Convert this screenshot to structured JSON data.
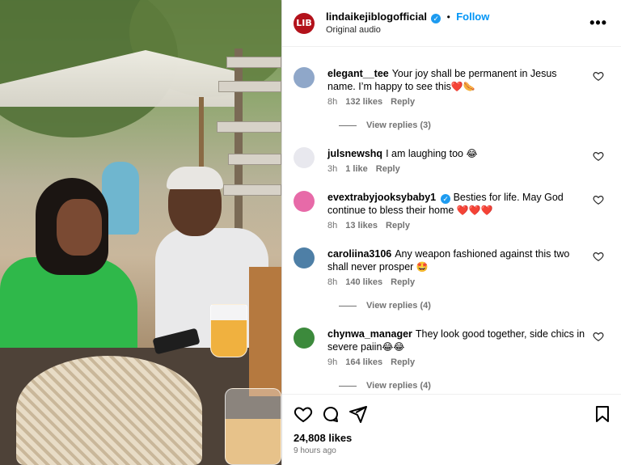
{
  "header": {
    "username": "lindaikejiblogofficial",
    "verified_mark": "✓",
    "dot": "•",
    "follow_label": "Follow",
    "subtitle": "Original audio",
    "avatar_text": "LIB",
    "more_label": "•••"
  },
  "comments": [
    {
      "username": "elegant__tee",
      "text": "Your joy shall be permanent in Jesus name. I’m happy to see this",
      "emoji": "❤️🌭",
      "time": "8h",
      "likes": "132 likes",
      "reply": "Reply",
      "view_replies": "View replies (3)",
      "avatar_color": "#8fa7c9"
    },
    {
      "username": "julsnewshq",
      "text": "I am laughing too",
      "emoji": "😂",
      "time": "3h",
      "likes": "1 like",
      "reply": "Reply",
      "avatar_color": "#e8e8ee"
    },
    {
      "username": "evextrabyjooksybaby1",
      "verified_mark": "✓",
      "text": "Besties for life. May God continue to bless their home",
      "emoji": "❤️❤️❤️",
      "time": "8h",
      "likes": "13 likes",
      "reply": "Reply",
      "avatar_color": "#e76aa8"
    },
    {
      "username": "caroliina3106",
      "text": "Any weapon fashioned against this two shall never prosper",
      "emoji": "🤩",
      "time": "8h",
      "likes": "140 likes",
      "reply": "Reply",
      "view_replies": "View replies (4)",
      "avatar_color": "#4e7fa6"
    },
    {
      "username": "chynwa_manager",
      "text": "They look good together, side chics in severe paiin",
      "emoji": "😂😂",
      "time": "9h",
      "likes": "164 likes",
      "reply": "Reply",
      "view_replies": "View replies (4)",
      "avatar_color": "#3c8a3c"
    }
  ],
  "footer": {
    "likes": "24,808 likes",
    "time": "9 hours ago"
  },
  "icons": [
    "like-icon",
    "comment-icon",
    "share-icon",
    "save-icon",
    "heart-outline-icon",
    "more-icon"
  ],
  "colors": {
    "accent": "#0095f6",
    "brand": "#b3121b",
    "muted": "#737373"
  }
}
